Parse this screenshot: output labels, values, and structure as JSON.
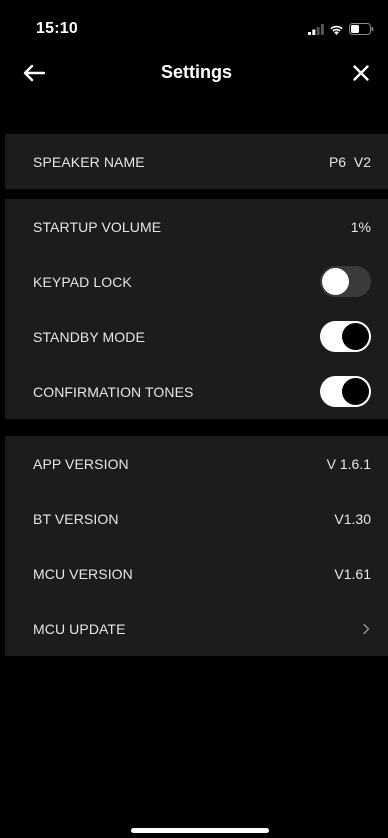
{
  "status_bar": {
    "time": "15:10",
    "icons": [
      "signal-icon",
      "wifi-icon",
      "battery-icon"
    ]
  },
  "nav": {
    "title": "Settings",
    "back_icon": "arrow-left-icon",
    "close_icon": "close-icon"
  },
  "speaker_section": {
    "name_label": "SPEAKER NAME",
    "name_value": "P6  V2"
  },
  "settings_section": {
    "startup_volume_label": "STARTUP VOLUME",
    "startup_volume_value": "1%",
    "keypad_lock_label": "KEYPAD LOCK",
    "keypad_lock_on": false,
    "standby_mode_label": "STANDBY MODE",
    "standby_mode_on": true,
    "confirmation_tones_label": "CONFIRMATION TONES",
    "confirmation_tones_on": true
  },
  "info_section": {
    "app_version_label": "APP VERSION",
    "app_version_value": "V 1.6.1",
    "bt_version_label": "BT VERSION",
    "bt_version_value": "V1.30",
    "mcu_version_label": "MCU VERSION",
    "mcu_version_value": "V1.61",
    "mcu_update_label": "MCU UPDATE"
  },
  "colors": {
    "background": "#000000",
    "section": "#1c1c1c",
    "text": "#e6e6e6",
    "toggle_off": "#3a3a3c",
    "toggle_on": "#ffffff"
  }
}
